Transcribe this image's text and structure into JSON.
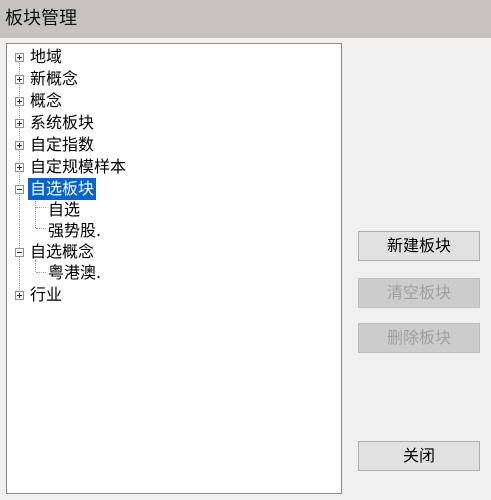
{
  "window": {
    "title": "板块管理"
  },
  "tree": {
    "nodes": [
      {
        "label": "地域",
        "expanded": false
      },
      {
        "label": "新概念",
        "expanded": false
      },
      {
        "label": "概念",
        "expanded": false
      },
      {
        "label": "系统板块",
        "expanded": false
      },
      {
        "label": "自定指数",
        "expanded": false
      },
      {
        "label": "自定规模样本",
        "expanded": false
      },
      {
        "label": "自选板块",
        "expanded": true,
        "selected": true,
        "children": [
          {
            "label": "自选"
          },
          {
            "label": "强势股."
          }
        ]
      },
      {
        "label": "自选概念",
        "expanded": true,
        "children": [
          {
            "label": "粤港澳."
          }
        ]
      },
      {
        "label": "行业",
        "expanded": false
      }
    ]
  },
  "buttons": {
    "new_label": "新建板块",
    "clear_label": "清空板块",
    "delete_label": "删除板块",
    "close_label": "关闭"
  }
}
